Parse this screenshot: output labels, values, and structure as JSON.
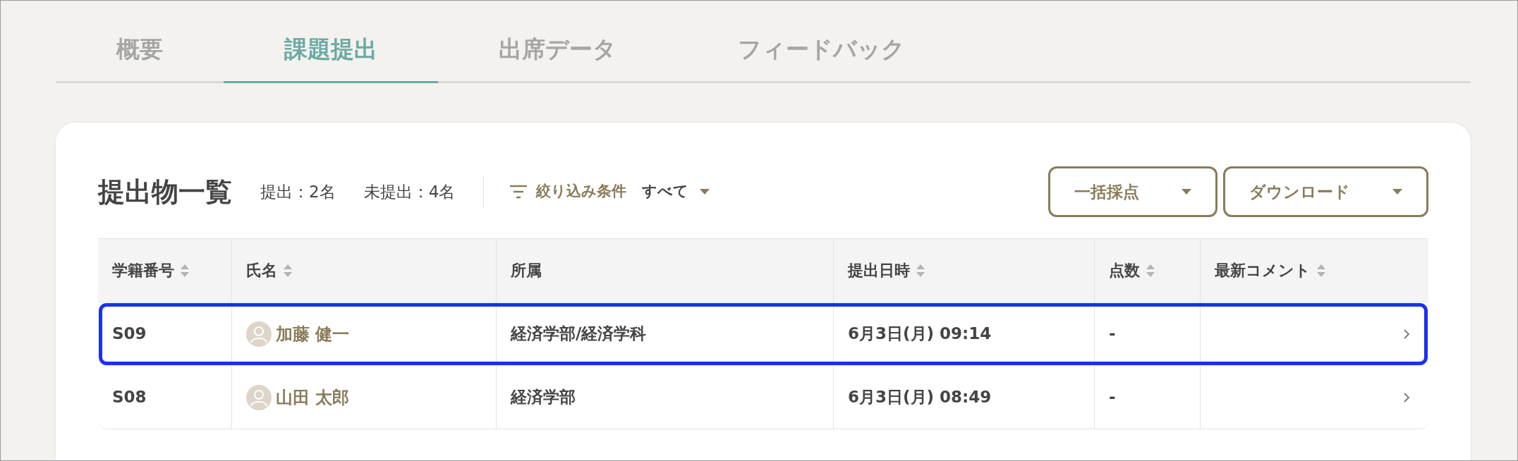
{
  "tabs": [
    {
      "label": "概要",
      "selected": false
    },
    {
      "label": "課題提出",
      "selected": true
    },
    {
      "label": "出席データ",
      "selected": false
    },
    {
      "label": "フィードバック",
      "selected": false
    }
  ],
  "panel": {
    "title": "提出物一覧",
    "submitted": "提出：2名",
    "not_submitted": "未提出：4名",
    "filter_label": "絞り込み条件",
    "filter_value": "すべて",
    "buttons": [
      "一括採点",
      "ダウンロード"
    ]
  },
  "table": {
    "columns": [
      {
        "label": "学籍番号",
        "sortable": true
      },
      {
        "label": "氏名",
        "sortable": true
      },
      {
        "label": "所属",
        "sortable": false
      },
      {
        "label": "提出日時",
        "sortable": true
      },
      {
        "label": "点数",
        "sortable": true
      },
      {
        "label": "最新コメント",
        "sortable": true
      }
    ],
    "rows": [
      {
        "id": "S09",
        "name": "加藤 健一",
        "affiliation": "経済学部/経済学科",
        "submitted_at": "6月3日(月) 09:14",
        "score": "-",
        "selected": true
      },
      {
        "id": "S08",
        "name": "山田 太郎",
        "affiliation": "経済学部",
        "submitted_at": "6月3日(月) 08:49",
        "score": "-",
        "selected": false
      }
    ]
  }
}
